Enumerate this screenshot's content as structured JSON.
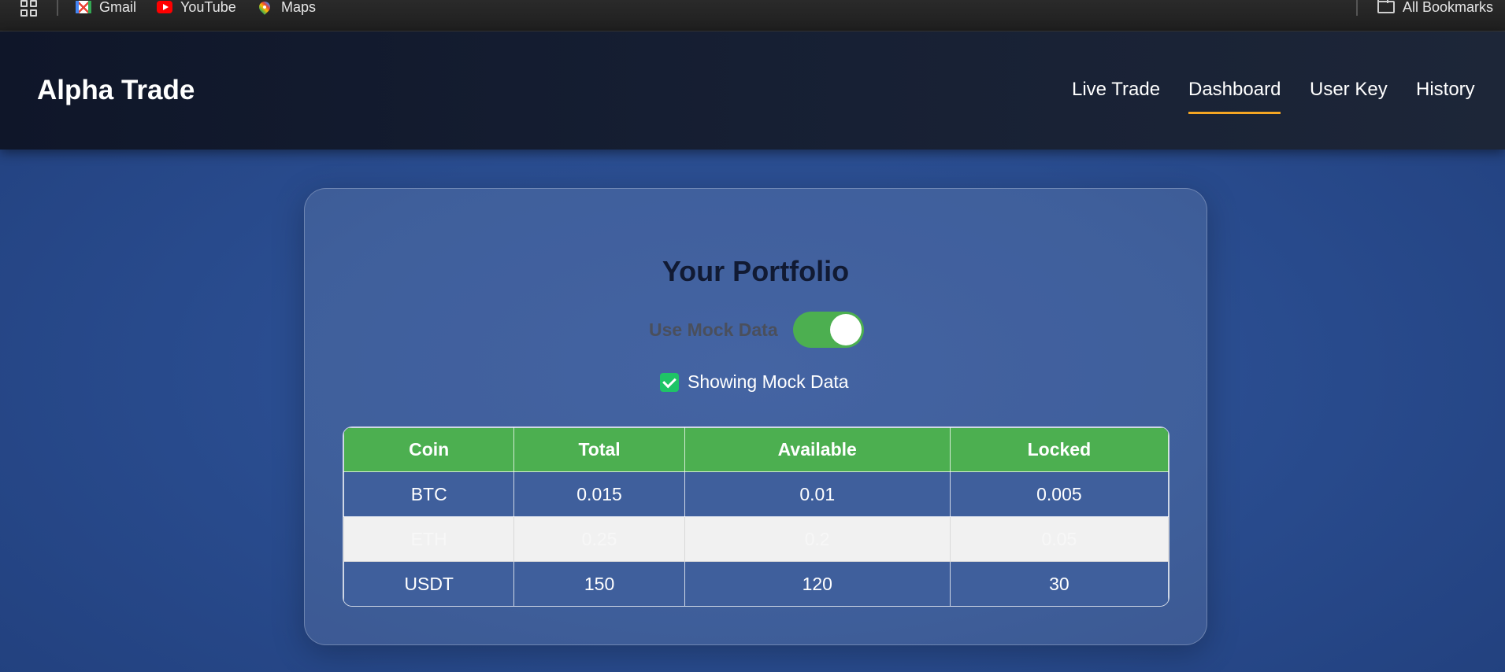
{
  "bookmarks_bar": {
    "items": [
      {
        "label": "Gmail",
        "icon": "gmail-icon"
      },
      {
        "label": "YouTube",
        "icon": "youtube-icon"
      },
      {
        "label": "Maps",
        "icon": "maps-icon"
      }
    ],
    "all_bookmarks": "All Bookmarks"
  },
  "header": {
    "brand": "Alpha Trade",
    "nav": [
      {
        "label": "Live Trade",
        "active": false
      },
      {
        "label": "Dashboard",
        "active": true
      },
      {
        "label": "User Key",
        "active": false
      },
      {
        "label": "History",
        "active": false
      }
    ]
  },
  "portfolio": {
    "title": "Your Portfolio",
    "toggle_label": "Use Mock Data",
    "toggle_on": true,
    "mock_status": "Showing Mock Data",
    "columns": [
      "Coin",
      "Total",
      "Available",
      "Locked"
    ],
    "rows": [
      [
        "BTC",
        "0.015",
        "0.01",
        "0.005"
      ],
      [
        "ETH",
        "0.25",
        "0.2",
        "0.05"
      ],
      [
        "USDT",
        "150",
        "120",
        "30"
      ]
    ]
  },
  "colors": {
    "accent_green": "#4caf50",
    "nav_underline": "#f5a623",
    "checkbox_green": "#1fc466"
  }
}
